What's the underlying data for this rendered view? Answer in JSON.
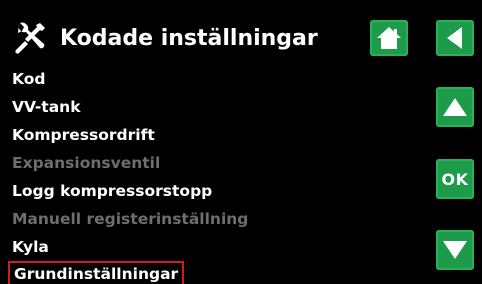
{
  "header": {
    "title": "Kodade inställningar",
    "icon": "tools-icon"
  },
  "buttons": {
    "home": {
      "icon": "home-icon"
    },
    "back": {
      "icon": "back-arrow-icon"
    },
    "up": {
      "icon": "up-arrow-icon"
    },
    "ok": {
      "label": "OK"
    },
    "down": {
      "icon": "down-arrow-icon"
    }
  },
  "menu": {
    "items": [
      {
        "label": "Kod",
        "state": "enabled"
      },
      {
        "label": "VV-tank",
        "state": "enabled"
      },
      {
        "label": "Kompressordrift",
        "state": "enabled"
      },
      {
        "label": "Expansionsventil",
        "state": "disabled"
      },
      {
        "label": "Logg kompressorstopp",
        "state": "enabled"
      },
      {
        "label": "Manuell registerinställning",
        "state": "disabled"
      },
      {
        "label": "Kyla",
        "state": "enabled"
      },
      {
        "label": "Grundinställningar",
        "state": "selected"
      }
    ]
  },
  "colors": {
    "background": "#000000",
    "button_green": "#1e9a4b",
    "text": "#ffffff",
    "disabled_text": "#6e6e6e",
    "selection_border": "#d01c1c"
  }
}
